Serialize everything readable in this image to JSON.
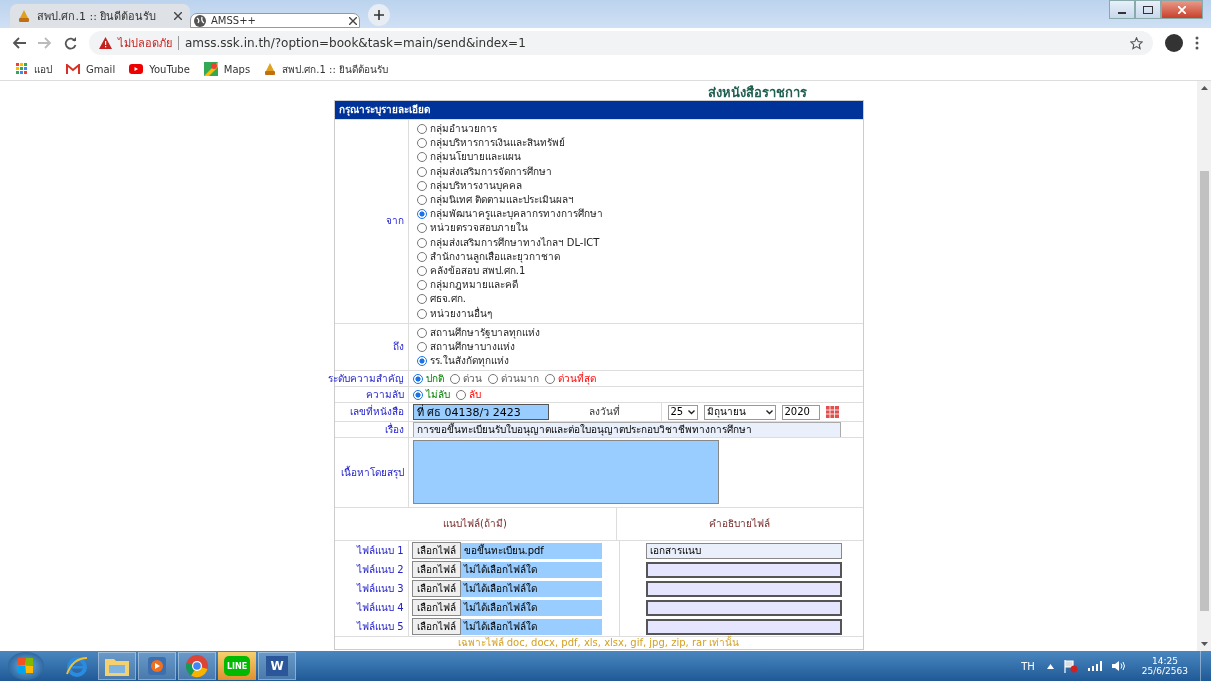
{
  "browser": {
    "tabs": [
      {
        "title": "สพป.ศก.1 :: ยินดีต้อนรับ",
        "kind": "emblem",
        "selected": false
      },
      {
        "title": "AMSS++",
        "kind": "globe",
        "selected": true
      }
    ],
    "security_label": "ไม่ปลอดภัย",
    "url": "amss.ssk.in.th/?option=book&task=main/send&index=1",
    "bookmarks": [
      {
        "label": "แอป",
        "kind": "apps"
      },
      {
        "label": "Gmail",
        "kind": "gmail"
      },
      {
        "label": "YouTube",
        "kind": "youtube"
      },
      {
        "label": "Maps",
        "kind": "maps"
      },
      {
        "label": "สพป.ศก.1 :: ยินดีต้อนรับ",
        "kind": "emblem"
      }
    ]
  },
  "page": {
    "title": "ส่งหนังสือราชการ",
    "form_header": "กรุณาระบุรายละเอียด",
    "from": {
      "label": "จาก",
      "options": [
        {
          "label": "กลุ่มอำนวยการ",
          "selected": false
        },
        {
          "label": "กลุ่มบริหารการเงินและสินทรัพย์",
          "selected": false
        },
        {
          "label": "กลุ่มนโยบายและแผน",
          "selected": false
        },
        {
          "label": "กลุ่มส่งเสริมการจัดการศึกษา",
          "selected": false
        },
        {
          "label": "กลุ่มบริหารงานบุคคล",
          "selected": false
        },
        {
          "label": "กลุ่มนิเทศ ติดตามและประเมินผลฯ",
          "selected": false
        },
        {
          "label": "กลุ่มพัฒนาครูและบุคลากรทางการศึกษา",
          "selected": true
        },
        {
          "label": "หน่วยตรวจสอบภายใน",
          "selected": false
        },
        {
          "label": "กลุ่มส่งเสริมการศึกษาทางไกลฯ DL-ICT",
          "selected": false
        },
        {
          "label": "สำนักงานลูกเสือและยุวกาชาด",
          "selected": false
        },
        {
          "label": "คลังข้อสอบ สพป.ศก.1",
          "selected": false
        },
        {
          "label": "กลุ่มกฎหมายและคดี",
          "selected": false
        },
        {
          "label": "ศธจ.ศก.",
          "selected": false
        },
        {
          "label": "หน่วยงานอื่นๆ",
          "selected": false
        }
      ]
    },
    "to": {
      "label": "ถึง",
      "options": [
        {
          "label": "สถานศึกษารัฐบาลทุกแห่ง",
          "selected": false
        },
        {
          "label": "สถานศึกษาบางแห่ง",
          "selected": false
        },
        {
          "label": "รร.ในสังกัดทุกแห่ง",
          "selected": true
        }
      ]
    },
    "priority": {
      "label": "ระดับความสำคัญ",
      "options": [
        {
          "label": "ปกติ",
          "selected": true,
          "kind": "normal"
        },
        {
          "label": "ด่วน",
          "selected": false,
          "kind": "urgent"
        },
        {
          "label": "ด่วนมาก",
          "selected": false,
          "kind": "urgent"
        },
        {
          "label": "ด่วนที่สุด",
          "selected": false,
          "kind": "critical"
        }
      ]
    },
    "secrecy": {
      "label": "ความลับ",
      "options": [
        {
          "label": "ไม่ลับ",
          "selected": true,
          "kind": "normal"
        },
        {
          "label": "ลับ",
          "selected": false,
          "kind": "critical"
        }
      ]
    },
    "doc_number": {
      "label": "เลขที่หนังสือ",
      "value": "ที่ ศธ 04138/ว 2423"
    },
    "date": {
      "label": "ลงวันที่",
      "day": "25",
      "month": "มิถุนายน",
      "year": "2020"
    },
    "subject": {
      "label": "เรื่อง",
      "value": "การขอขึ้นทะเบียนรับใบอนุญาตและต่อใบอนุญาตประกอบวิชาชีพทางการศึกษา"
    },
    "summary": {
      "label": "เนื้อหาโดยสรุป"
    },
    "attachments": {
      "columns": [
        "แนบไฟล์(ถ้ามี)",
        "คำอธิบายไฟล์"
      ],
      "rows": [
        {
          "label": "ไฟล์แนบ 1",
          "button": "เลือกไฟล์",
          "file": "ขอขึ้นทะเบียน.pdf",
          "description": "เอกสารแนบ"
        },
        {
          "label": "ไฟล์แนบ 2",
          "button": "เลือกไฟล์",
          "file": "ไม่ได้เลือกไฟล์ใด"
        },
        {
          "label": "ไฟล์แนบ 3",
          "button": "เลือกไฟล์",
          "file": "ไม่ได้เลือกไฟล์ใด"
        },
        {
          "label": "ไฟล์แนบ 4",
          "button": "เลือกไฟล์",
          "file": "ไม่ได้เลือกไฟล์ใด"
        },
        {
          "label": "ไฟล์แนบ 5",
          "button": "เลือกไฟล์",
          "file": "ไม่ได้เลือกไฟล์ใด"
        }
      ],
      "note": "เฉพาะไฟล์ doc, docx, pdf, xls, xlsx, gif, jpg, zip, rar เท่านั้น"
    }
  },
  "taskbar": {
    "apps": [
      {
        "kind": "ie"
      },
      {
        "kind": "folder"
      },
      {
        "kind": "media"
      },
      {
        "kind": "chrome"
      },
      {
        "kind": "line",
        "label": "LINE"
      },
      {
        "kind": "word",
        "label": "W"
      }
    ],
    "language": "TH",
    "time": "14:25",
    "date": "25/6/2563"
  }
}
